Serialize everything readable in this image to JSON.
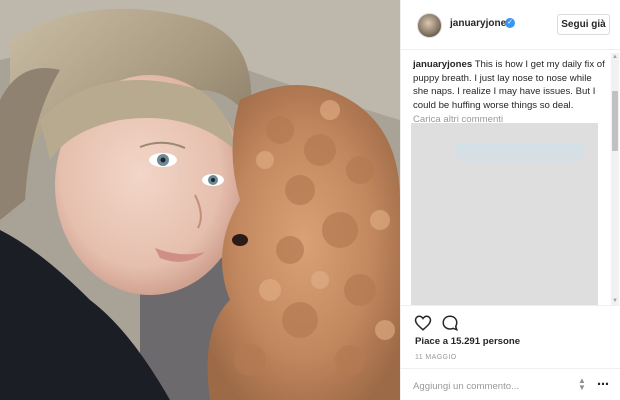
{
  "post": {
    "username": "januaryjones",
    "verified_icon": "verified-badge-icon",
    "follow_label": "Segui già",
    "caption": {
      "user": "januaryjones",
      "text": "This is how I get my daily fix of puppy breath. I just lay nose to nose while she naps. I realize I may have issues. But I could be huffing worse things so deal."
    },
    "load_more_label": "Carica altri commenti",
    "likes_label": "Piace a 15.291 persone",
    "date_label": "11 MAGGIO",
    "comment_placeholder": "Aggiungi un commento..."
  },
  "icons": {
    "like": "heart-outline-icon",
    "comment": "speech-bubble-icon",
    "sort": "sort-arrows-icon",
    "more": "more-options-icon"
  },
  "colors": {
    "verified": "#3897f0",
    "text": "#262626",
    "muted": "#999999",
    "border": "#dbdbdb"
  }
}
